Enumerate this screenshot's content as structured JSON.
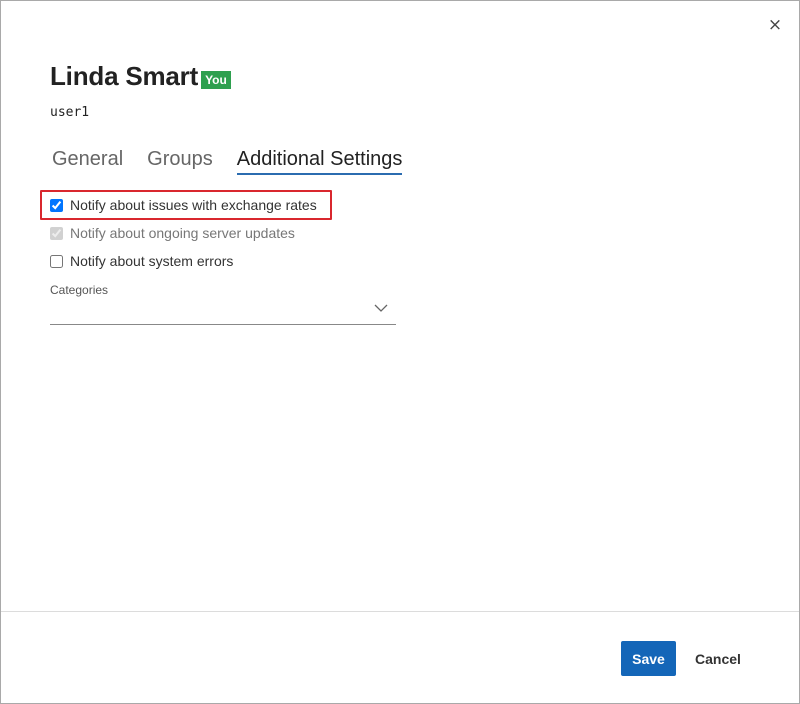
{
  "dialog": {
    "close_glyph": "×",
    "user_name": "Linda Smart",
    "badge": "You",
    "username": "user1"
  },
  "tabs": [
    {
      "label": "General",
      "active": false
    },
    {
      "label": "Groups",
      "active": false
    },
    {
      "label": "Additional Settings",
      "active": true
    }
  ],
  "options": [
    {
      "label": "Notify about issues with exchange rates",
      "checked": true,
      "disabled": false
    },
    {
      "label": "Notify about ongoing server updates",
      "checked": true,
      "disabled": true
    },
    {
      "label": "Notify about system errors",
      "checked": false,
      "disabled": false
    }
  ],
  "categories": {
    "label": "Categories",
    "value": ""
  },
  "footer": {
    "save_label": "Save",
    "cancel_label": "Cancel"
  },
  "colors": {
    "badge": "#2ea04f",
    "primary": "#1466b8",
    "highlight": "#d9272e",
    "tab_underline": "#2b6cb0"
  },
  "icons": {
    "close": "close-icon",
    "dropdown": "chevron-down-icon"
  }
}
